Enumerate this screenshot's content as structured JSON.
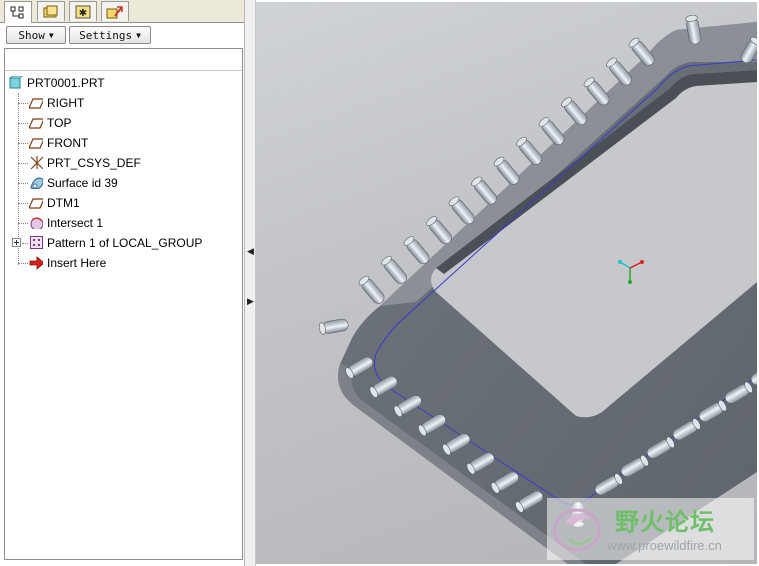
{
  "navigator": {
    "tabs": [
      {
        "icon": "model-tree-icon",
        "active": true
      },
      {
        "icon": "folder-browser-icon",
        "active": false
      },
      {
        "icon": "favorites-icon",
        "active": false
      },
      {
        "icon": "connections-icon",
        "active": false
      }
    ],
    "toolbar": {
      "show_label": "Show",
      "settings_label": "Settings"
    },
    "tree": {
      "root_label": "PRT0001.PRT",
      "items": [
        {
          "label": "RIGHT",
          "icon": "datum-plane-icon"
        },
        {
          "label": "TOP",
          "icon": "datum-plane-icon"
        },
        {
          "label": "FRONT",
          "icon": "datum-plane-icon"
        },
        {
          "label": "PRT_CSYS_DEF",
          "icon": "coordinate-system-icon"
        },
        {
          "label": "Surface id 39",
          "icon": "surface-icon"
        },
        {
          "label": "DTM1",
          "icon": "datum-plane-icon"
        },
        {
          "label": "Intersect 1",
          "icon": "intersect-curve-icon"
        },
        {
          "label": "Pattern 1 of LOCAL_GROUP",
          "icon": "pattern-icon",
          "expandable": true
        },
        {
          "label": "Insert Here",
          "icon": "insert-arrow-icon"
        }
      ]
    }
  },
  "watermark": {
    "title": "野火论坛",
    "url": "www.proewildfire.cn"
  },
  "colors": {
    "model_surface": "#6a6f76",
    "background_top": "#cfd2d6",
    "curve": "#3a3acc",
    "watermark_green": "#6ebf68"
  }
}
